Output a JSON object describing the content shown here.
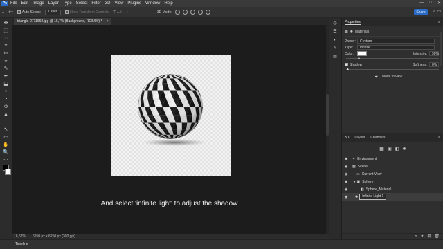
{
  "menu": {
    "logo": "Ps",
    "items": [
      "File",
      "Edit",
      "Image",
      "Layer",
      "Type",
      "Select",
      "Filter",
      "3D",
      "View",
      "Plugins",
      "Window",
      "Help"
    ]
  },
  "window_controls": [
    "—",
    "□",
    "✕"
  ],
  "options": {
    "auto_select_label": "Auto-Select:",
    "auto_select_target": "Layer",
    "transform_controls_label": "Show Transform Controls",
    "mode_3d_label": "3D Mode:",
    "share_label": "Share"
  },
  "tools": [
    "✥",
    "⬚",
    "◌",
    "⌗",
    "✂",
    "⌖",
    "✎",
    "✒",
    "⬓",
    "✦",
    "◔",
    "⊘",
    "▲",
    "T",
    "↖",
    "▭",
    "✋",
    "🔍",
    "⋯"
  ],
  "document": {
    "tab_title": "triangle-2711662.jpg @ 16,7% (Background, RGB/8#) *",
    "tab_close": "×"
  },
  "caption": "And select 'infinite light' to adjust the shadow",
  "status": {
    "zoom": "16,67%",
    "dimensions": "6250 px x 6250 px (300 ppi)"
  },
  "timeline": {
    "label": "Timeline"
  },
  "properties": {
    "tab": "Properties",
    "section": "Materials",
    "preset_label": "Preset:",
    "preset_value": "Custom",
    "type_label": "Type:",
    "type_value": "Infinite",
    "color_label": "Color:",
    "intensity_label": "Intensity:",
    "intensity_value": "90%",
    "shadow_label": "Shadow",
    "softness_label": "Softness:",
    "softness_value": "0%",
    "move_to_view": "Move to view",
    "colors": {
      "light_color": "#ffffff"
    }
  },
  "panel3d": {
    "tabs": [
      "3D",
      "Layers",
      "Channels"
    ],
    "layers": [
      {
        "name": "Environment",
        "indent": 0
      },
      {
        "name": "Scene",
        "indent": 0
      },
      {
        "name": "Current View",
        "indent": 1
      },
      {
        "name": "Sphere",
        "indent": 1
      },
      {
        "name": "Sphere_Material",
        "indent": 2
      },
      {
        "name": "Infinite Light 1",
        "indent": 1,
        "selected": true
      }
    ]
  }
}
